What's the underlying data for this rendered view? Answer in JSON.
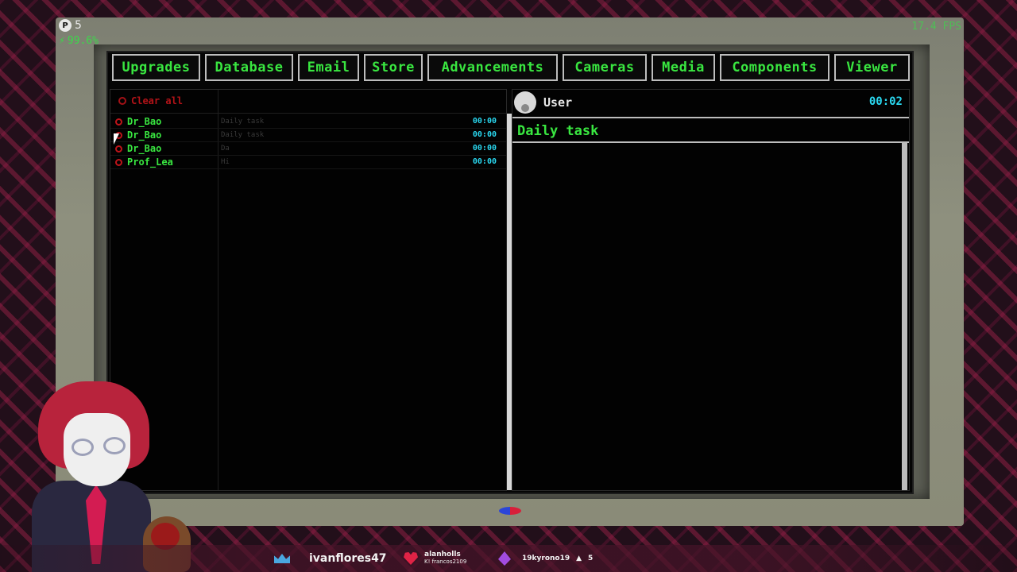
{
  "overlay": {
    "counter_icon": "P",
    "counter_value": "5",
    "percent": "99.6%",
    "fps": "17.4 FPS"
  },
  "tabs": [
    {
      "label": "Upgrades"
    },
    {
      "label": "Database"
    },
    {
      "label": "Email"
    },
    {
      "label": "Store"
    },
    {
      "label": "Advancements"
    },
    {
      "label": "Cameras"
    },
    {
      "label": "Media"
    },
    {
      "label": "Components"
    },
    {
      "label": "Viewer"
    }
  ],
  "email_list": {
    "clear_all_label": "Clear all",
    "messages": [
      {
        "sender": "Dr_Bao",
        "subject": "Daily task",
        "time": "00:00"
      },
      {
        "sender": "Dr_Bao",
        "subject": "Daily task",
        "time": "00:00"
      },
      {
        "sender": "Dr_Bao",
        "subject": "Da",
        "time": "00:00"
      },
      {
        "sender": "Prof_Lea",
        "subject": "Hi",
        "time": "00:00"
      }
    ]
  },
  "message_view": {
    "from": "User",
    "time": "00:02",
    "subject": "Daily task",
    "body": ""
  },
  "stream_ticker": {
    "subscriber": "ivanflores47",
    "donor_name": "alanholls",
    "donor_sub": "K! francos2109",
    "gifter": "19kyrono19",
    "gift_count": "5"
  },
  "colors": {
    "accent_green": "#39e640",
    "time_cyan": "#2ad8f0",
    "alert_red": "#d2161c"
  }
}
